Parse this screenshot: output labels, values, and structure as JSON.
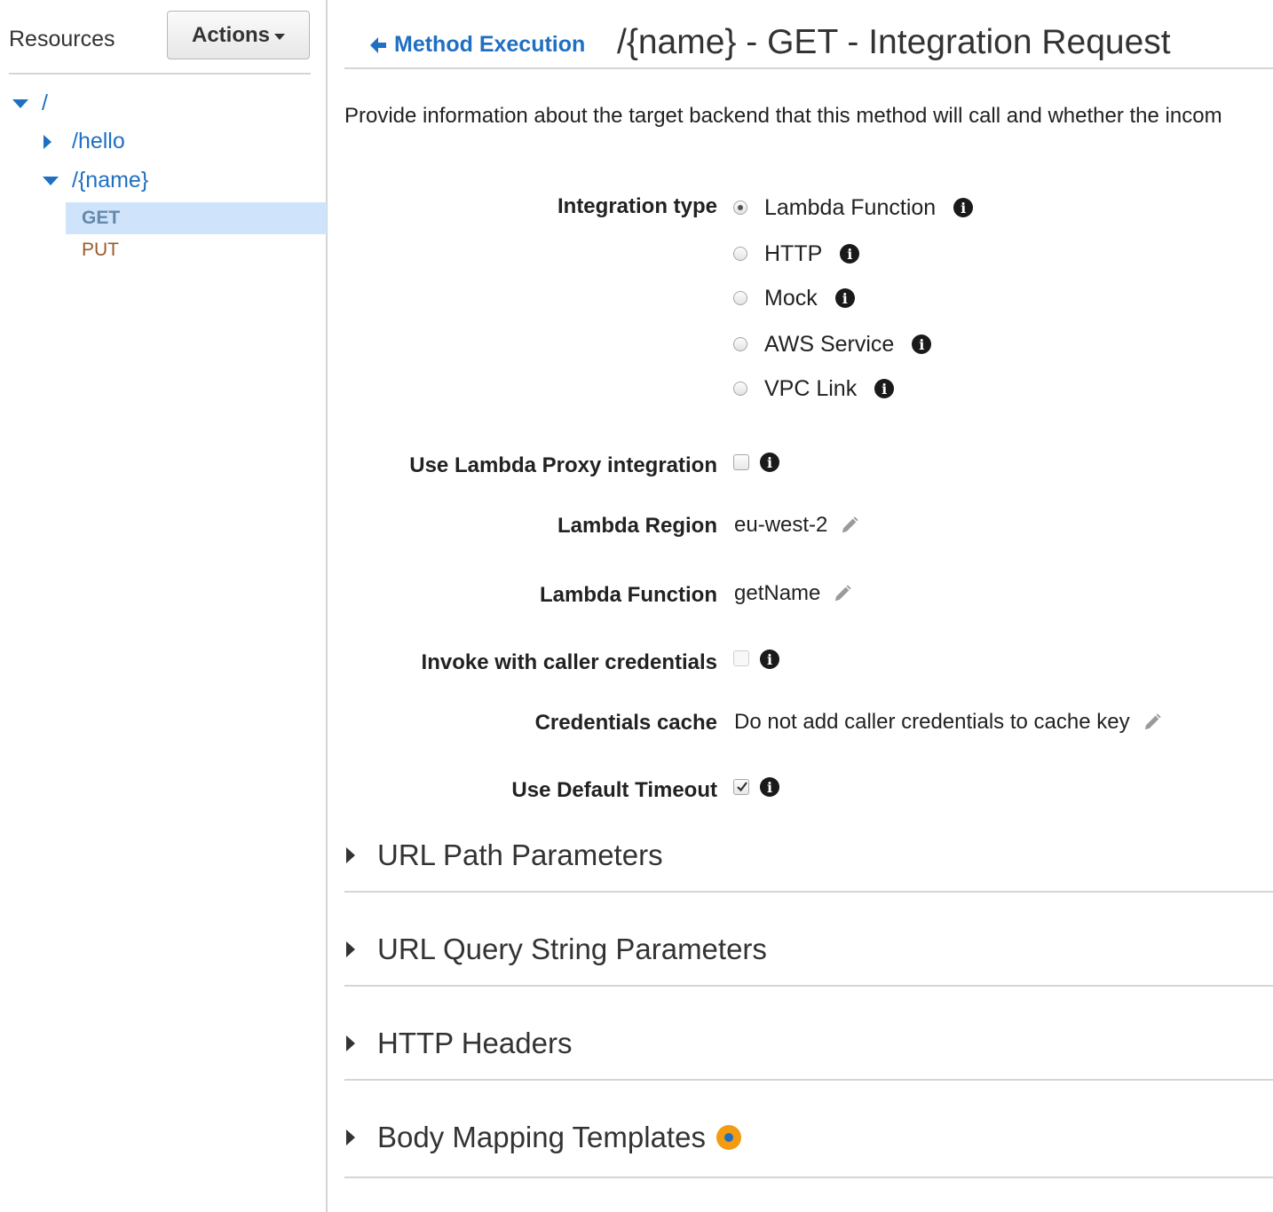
{
  "sidebar": {
    "title": "Resources",
    "actions_label": "Actions",
    "tree": {
      "root": "/",
      "hello": "/hello",
      "name": "/{name}",
      "methods": [
        "GET",
        "PUT"
      ]
    }
  },
  "header": {
    "back_label": "Method Execution",
    "title": "/{name} - GET - Integration Request"
  },
  "description": "Provide information about the target backend that this method will call and whether the incom",
  "form": {
    "integration_type": {
      "label": "Integration type",
      "options": [
        "Lambda Function",
        "HTTP",
        "Mock",
        "AWS Service",
        "VPC Link"
      ],
      "selected": "Lambda Function"
    },
    "lambda_proxy": {
      "label": "Use Lambda Proxy integration",
      "checked": false
    },
    "lambda_region": {
      "label": "Lambda Region",
      "value": "eu-west-2"
    },
    "lambda_function": {
      "label": "Lambda Function",
      "value": "getName"
    },
    "invoke_caller": {
      "label": "Invoke with caller credentials",
      "checked": false
    },
    "credentials_cache": {
      "label": "Credentials cache",
      "value": "Do not add caller credentials to cache key"
    },
    "default_timeout": {
      "label": "Use Default Timeout",
      "checked": true
    }
  },
  "sections": [
    "URL Path Parameters",
    "URL Query String Parameters",
    "HTTP Headers",
    "Body Mapping Templates"
  ],
  "colors": {
    "link": "#1f6fc2",
    "selected_bg": "#cfe4fb",
    "put_method": "#9a5a2a",
    "warning": "#f39c12",
    "divider": "#d5d5d5"
  }
}
